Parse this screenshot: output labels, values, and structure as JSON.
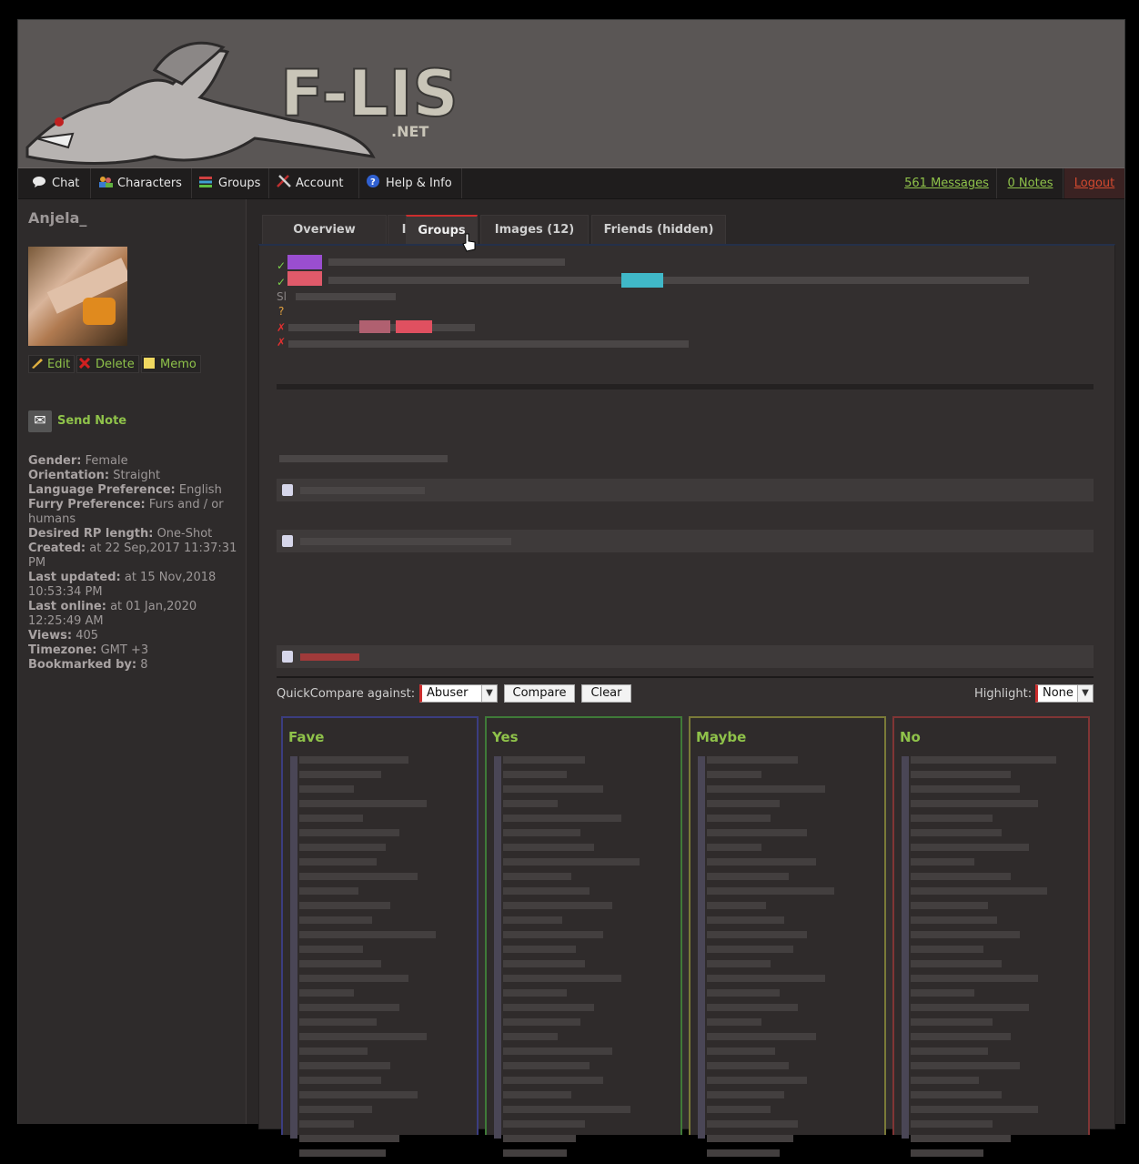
{
  "header": {
    "site_logo_text": "F-LIST .NET"
  },
  "nav": {
    "items": [
      {
        "label": "Chat",
        "icon": "speech-bubble-icon"
      },
      {
        "label": "Characters",
        "icon": "people-icon"
      },
      {
        "label": "Groups",
        "icon": "stack-icon"
      },
      {
        "label": "Account",
        "icon": "tools-icon"
      },
      {
        "label": "Help & Info",
        "icon": "help-icon"
      }
    ],
    "messages": "561 Messages",
    "notes": "0 Notes",
    "logout": "Logout"
  },
  "sidebar": {
    "character_name": "Anjela_",
    "actions": {
      "edit": "Edit",
      "delete": "Delete",
      "memo": "Memo"
    },
    "send_note": "Send Note",
    "stats": [
      {
        "label": "Gender",
        "value": "Female"
      },
      {
        "label": "Orientation",
        "value": "Straight"
      },
      {
        "label": "Language Preference",
        "value": "English"
      },
      {
        "label": "Furry Preference",
        "value": "Furs and / or humans"
      },
      {
        "label": "Desired RP length",
        "value": "One-Shot"
      },
      {
        "label": "Created",
        "value": "at 22 Sep,2017 11:37:31 PM"
      },
      {
        "label": "Last updated",
        "value": "at 15 Nov,2018 10:53:34 PM"
      },
      {
        "label": "Last online",
        "value": "at 01 Jan,2020 12:25:49 AM"
      },
      {
        "label": "Views",
        "value": "405"
      },
      {
        "label": "Timezone",
        "value": "GMT +3"
      },
      {
        "label": "Bookmarked by",
        "value": "8"
      }
    ]
  },
  "tabs": [
    {
      "label": "Overview"
    },
    {
      "label": "Info"
    },
    {
      "label": "Groups",
      "active": true
    },
    {
      "label": "Images (12)"
    },
    {
      "label": "Friends (hidden)"
    }
  ],
  "overview": {
    "partial_text": "Sl",
    "marks": [
      "✓",
      "✓",
      "?",
      "✗",
      "✗"
    ]
  },
  "quickcompare": {
    "label": "QuickCompare against:",
    "selected": "Abuser",
    "compare": "Compare",
    "clear": "Clear",
    "highlight_label": "Highlight:",
    "highlight_selected": "None"
  },
  "kink_columns": [
    {
      "title": "Fave",
      "color": "#3b3d80"
    },
    {
      "title": "Yes",
      "color": "#3f7a38"
    },
    {
      "title": "Maybe",
      "color": "#7a7a38"
    },
    {
      "title": "No",
      "color": "#803535"
    }
  ],
  "colors": {
    "accent_green": "#8fc24a",
    "logout_red": "#d2492f",
    "active_tab_red": "#cc2d2d"
  }
}
